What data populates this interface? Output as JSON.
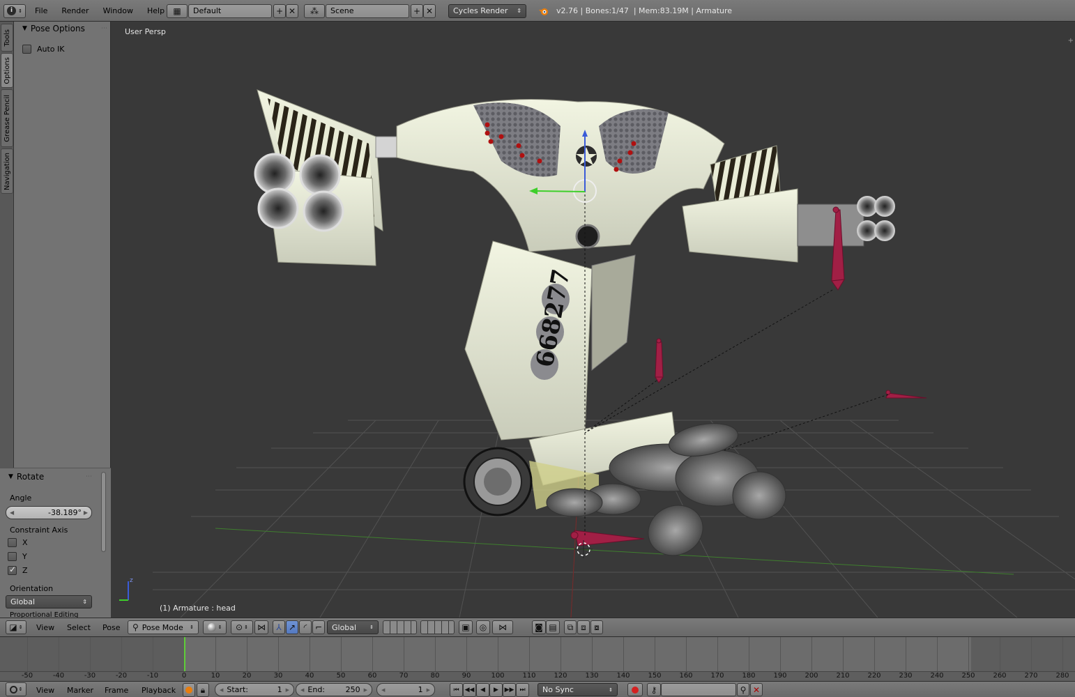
{
  "topbar": {
    "menus": [
      "File",
      "Render",
      "Window",
      "Help"
    ],
    "screen_layout": "Default",
    "scene": "Scene",
    "render_engine": "Cycles Render",
    "info": "v2.76 | Bones:1/47  | Mem:83.19M | Armature"
  },
  "vertical_tabs": [
    "Tools",
    "Options",
    "Grease Pencil",
    "Navigation"
  ],
  "pose_options": {
    "title": "Pose Options",
    "auto_ik_label": "Auto IK"
  },
  "rotate_panel": {
    "title": "Rotate",
    "angle_label": "Angle",
    "angle_value": "-38.189°",
    "constraint_label": "Constraint Axis",
    "axes": [
      {
        "label": "X",
        "checked": false
      },
      {
        "label": "Y",
        "checked": false
      },
      {
        "label": "Z",
        "checked": true
      }
    ],
    "orientation_label": "Orientation",
    "orientation_value": "Global",
    "proportional_label": "Proportional Editing"
  },
  "viewport": {
    "view_name": "User Persp",
    "status": "(1) Armature : head",
    "model_number": "668277"
  },
  "view3d_header": {
    "menus": [
      "View",
      "Select",
      "Pose"
    ],
    "mode": "Pose Mode",
    "orientation": "Global"
  },
  "timeline": {
    "ticks": [
      "-50",
      "-40",
      "-30",
      "-20",
      "-10",
      "0",
      "10",
      "20",
      "30",
      "40",
      "50",
      "60",
      "70",
      "80",
      "90",
      "100",
      "110",
      "120",
      "130",
      "140",
      "150",
      "160",
      "170",
      "180",
      "190",
      "200",
      "210",
      "220",
      "230",
      "240",
      "250",
      "260",
      "270",
      "280"
    ],
    "current_frame_value": 0
  },
  "bottombar": {
    "menus": [
      "View",
      "Marker",
      "Frame",
      "Playback"
    ],
    "start_label": "Start:",
    "start_value": "1",
    "end_label": "End:",
    "end_value": "250",
    "current_frame": "1",
    "sync": "No Sync"
  }
}
